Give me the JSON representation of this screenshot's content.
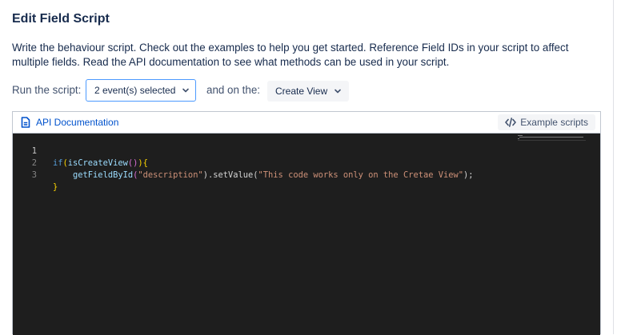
{
  "dialog": {
    "title": "Edit Field Script",
    "description": "Write the behaviour script. Check out the examples to help you get started. Reference Field IDs in your script to affect multiple fields. Read the API documentation to see what methods can be used in your script."
  },
  "run_controls": {
    "run_label": "Run the script:",
    "events_selected": "2 event(s) selected",
    "and_label": "and on the:",
    "view_selected": "Create View"
  },
  "editor": {
    "api_doc_label": "API Documentation",
    "example_scripts_label": "Example scripts",
    "line_numbers": [
      "1",
      "2",
      "3"
    ],
    "code": {
      "l1_kw": "if",
      "l1_open": "(",
      "l1_fn": "isCreateView",
      "l1_call": "()",
      "l1_close": ")",
      "l1_brace": "{",
      "l2_indent": "    ",
      "l2_fn": "getFieldById",
      "l2_open": "(",
      "l2_arg": "\"description\"",
      "l2_mid": ").setValue(",
      "l2_str": "\"This code works only on the Cretae View\"",
      "l2_end": ");",
      "l3_brace": "}"
    }
  },
  "colors": {
    "accent": "#0052cc",
    "focus_border": "#4c9aff",
    "editor_bg": "#1e1e1e"
  },
  "icons": {
    "api_doc": "document-icon",
    "example_scripts": "code-icon",
    "dropdown": "chevron-down-icon"
  }
}
